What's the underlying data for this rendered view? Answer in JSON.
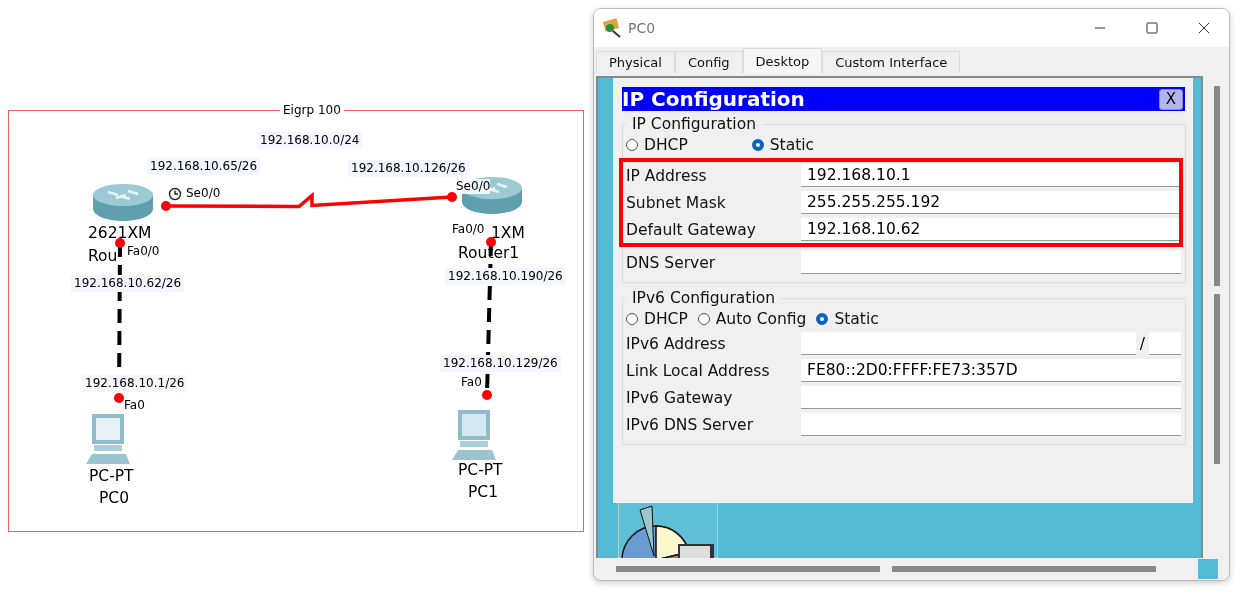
{
  "topology": {
    "area_label": "Eigrp 100",
    "network_label": "192.168.10.0/24",
    "devices": [
      {
        "kind": "router",
        "model": "2621XM",
        "name": "Rou"
      },
      {
        "kind": "router",
        "model": "1XM",
        "name": "Router1"
      },
      {
        "kind": "pc",
        "model": "PC-PT",
        "name": "PC0"
      },
      {
        "kind": "pc",
        "model": "PC-PT",
        "name": "PC1"
      }
    ],
    "links": [
      {
        "kind": "serial",
        "ends": [
          {
            "port": "Se0/0",
            "address": "192.168.10.65/26",
            "clock": true
          },
          {
            "port": "Se0/0",
            "address": "192.168.10.126/26",
            "clock": false
          }
        ]
      },
      {
        "kind": "ethernet",
        "ends": [
          {
            "port": "Fa0/0",
            "address": "192.168.10.62/26",
            "clock": false
          },
          {
            "port": "Fa0",
            "address": "192.168.10.1/26",
            "clock": false
          }
        ]
      },
      {
        "kind": "ethernet",
        "ends": [
          {
            "port": "Fa0/0",
            "address": "192.168.10.190/26",
            "clock": false
          },
          {
            "port": "Fa0",
            "address": "192.168.10.129/26",
            "clock": false
          }
        ]
      }
    ]
  },
  "window": {
    "title": "PC0",
    "tabs": [
      {
        "label": "Physical",
        "selected": false
      },
      {
        "label": "Config",
        "selected": false
      },
      {
        "label": "Desktop",
        "selected": true
      },
      {
        "label": "Custom Interface",
        "selected": false
      }
    ],
    "dialog": {
      "title": "IP Configuration",
      "close": "X",
      "ipv4": {
        "legend": "IP Configuration",
        "modes": [
          {
            "label": "DHCP",
            "selected": false
          },
          {
            "label": "Static",
            "selected": true
          }
        ],
        "fields": [
          {
            "label": "IP Address",
            "value": "192.168.10.1",
            "highlighted": true
          },
          {
            "label": "Subnet Mask",
            "value": "255.255.255.192",
            "highlighted": true
          },
          {
            "label": "Default Gateway",
            "value": "192.168.10.62",
            "highlighted": true
          },
          {
            "label": "DNS Server",
            "highlighted": false
          }
        ]
      },
      "ipv6": {
        "legend": "IPv6 Configuration",
        "modes": [
          {
            "label": "DHCP",
            "selected": false
          },
          {
            "label": "Auto Config",
            "selected": false
          },
          {
            "label": "Static",
            "selected": true
          }
        ],
        "fields": [
          {
            "label": "IPv6 Address",
            "kind": "prefix",
            "separator": "/"
          },
          {
            "label": "Link Local Address",
            "kind": "text",
            "value": "FE80::2D0:FFFF:FE73:357D"
          },
          {
            "label": "IPv6 Gateway",
            "kind": "text"
          },
          {
            "label": "IPv6 DNS Server",
            "kind": "text"
          }
        ]
      }
    }
  }
}
